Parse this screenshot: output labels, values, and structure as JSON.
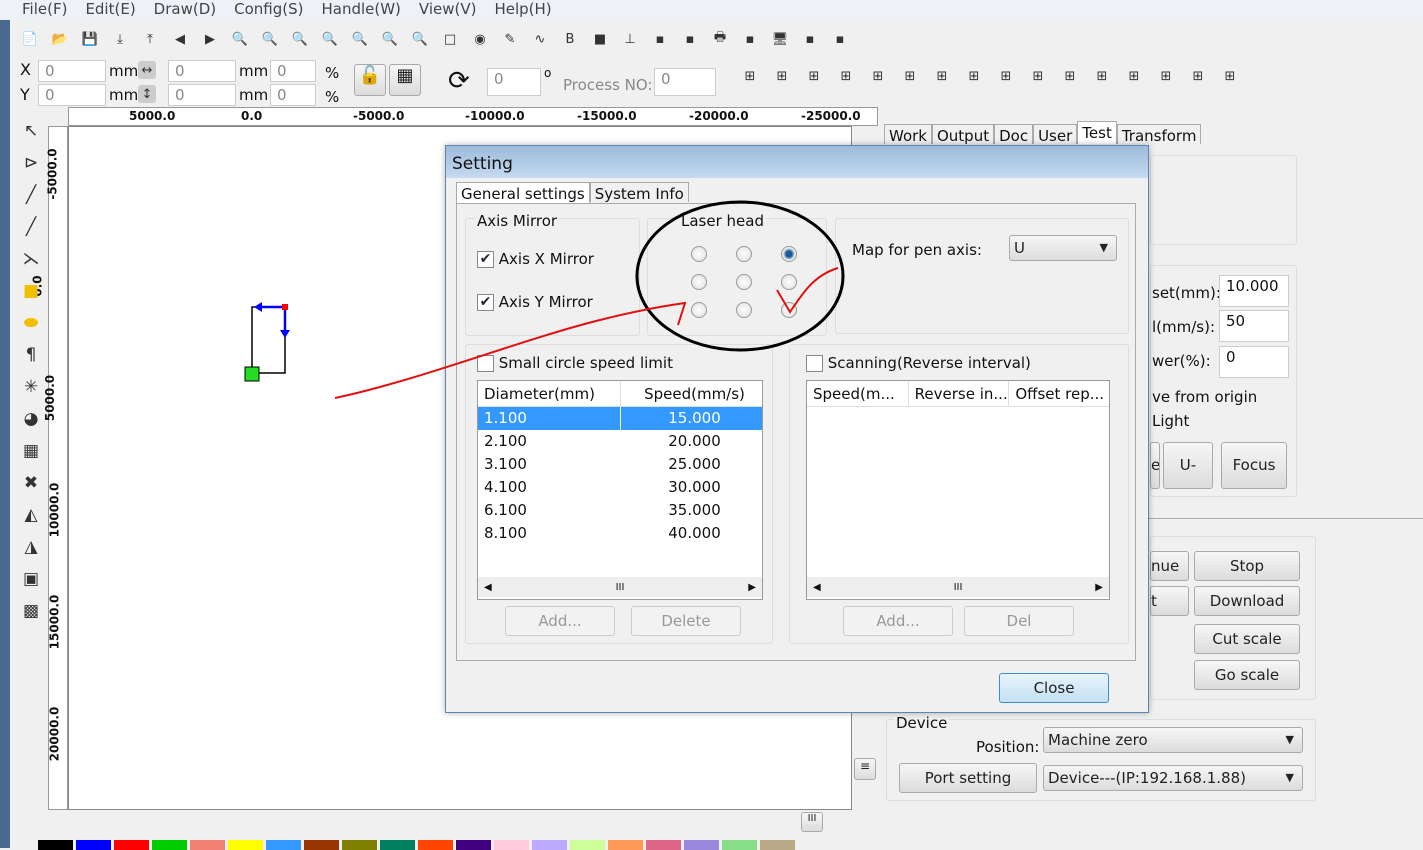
{
  "menu": [
    "File(F)",
    "Edit(E)",
    "Draw(D)",
    "Config(S)",
    "Handle(W)",
    "View(V)",
    "Help(H)"
  ],
  "toolbar_icons": [
    "new-file-icon",
    "open-folder-icon",
    "save-icon",
    "import-icon",
    "export-icon",
    "back-icon",
    "forward-icon",
    "zoom-fit-icon",
    "zoom-in-icon",
    "zoom-out-icon",
    "zoom-page-icon",
    "zoom-grid-icon",
    "zoom-all-icon",
    "zoom-select-icon",
    "rect-select-icon",
    "node-icon",
    "pen-icon",
    "curve-icon",
    "bmp-icon",
    "fill-icon",
    "tree-icon",
    "align-icon",
    "align2-icon",
    "printer-icon",
    "doc-icon",
    "monitor-icon",
    "group-icon",
    "ungroup-icon"
  ],
  "coords": {
    "x_label": "X",
    "y_label": "Y",
    "x": "0",
    "y": "0",
    "unit": "mm",
    "w": "0",
    "h": "0",
    "pct_x": "0",
    "pct_y": "0",
    "pct": "%",
    "rotation": "0",
    "degree": "o",
    "process_label": "Process NO:",
    "process_no": "0"
  },
  "ruler": {
    "h_ticks": [
      "5000.0",
      "0.0",
      "-5000.0",
      "-10000.0",
      "-15000.0",
      "-20000.0",
      "-25000.0"
    ],
    "v_ticks": [
      "-5000.0",
      "0.0",
      "5000.0",
      "10000.0",
      "15000.0",
      "20000.0"
    ]
  },
  "right_tabs": [
    "Work",
    "Output",
    "Doc",
    "User",
    "Test",
    "Transform"
  ],
  "right_active_tab": "Test",
  "test_panel": {
    "offset_label": "set(mm):",
    "offset": "10.000",
    "speed_label": "l(mm/s):",
    "speed": "50",
    "power_label": "wer(%):",
    "power": "0",
    "move_origin": "ve from origin",
    "light": "Light",
    "btn_e": "e",
    "btn_u": "U-",
    "btn_focus": "Focus"
  },
  "output_panel": {
    "continue": "nue",
    "start": "t",
    "stop": "Stop",
    "download": "Download",
    "cut_scale": "Cut scale",
    "go_scale": "Go scale"
  },
  "device": {
    "title": "Device",
    "position_label": "Position:",
    "position": "Machine zero",
    "port_setting": "Port setting",
    "device": "Device---(IP:192.168.1.88)"
  },
  "dialog": {
    "title": "Setting",
    "tabs": [
      "General settings",
      "System Info"
    ],
    "axis_mirror": {
      "title": "Axis Mirror",
      "x": "Axis X Mirror",
      "y": "Axis Y Mirror",
      "x_checked": true,
      "y_checked": true
    },
    "laser_head": {
      "title": "Laser head",
      "selected": "top-right"
    },
    "pen_axis": {
      "label": "Map for pen axis:",
      "value": "U"
    },
    "small_circle": {
      "label": "Small circle speed limit",
      "checked": false,
      "columns": [
        "Diameter(mm)",
        "Speed(mm/s)"
      ],
      "rows": [
        [
          "1.100",
          "15.000"
        ],
        [
          "2.100",
          "20.000"
        ],
        [
          "3.100",
          "25.000"
        ],
        [
          "4.100",
          "30.000"
        ],
        [
          "6.100",
          "35.000"
        ],
        [
          "8.100",
          "40.000"
        ]
      ],
      "add": "Add...",
      "delete": "Delete"
    },
    "scanning": {
      "label": "Scanning(Reverse interval)",
      "checked": false,
      "columns": [
        "Speed(m...",
        "Reverse in...",
        "Offset rep..."
      ],
      "add": "Add...",
      "del": "Del"
    },
    "close": "Close"
  },
  "palette": [
    "#000000",
    "#0000ff",
    "#ff0000",
    "#00cc00",
    "#f08070",
    "#ffff00",
    "#3399ff",
    "#993300",
    "#808000",
    "#008060",
    "#ff4400",
    "#400080",
    "#ffccdd",
    "#bbaaff",
    "#ccff99",
    "#ff9955",
    "#dd6688",
    "#9988dd",
    "#88dd88",
    "#bbaa88"
  ]
}
